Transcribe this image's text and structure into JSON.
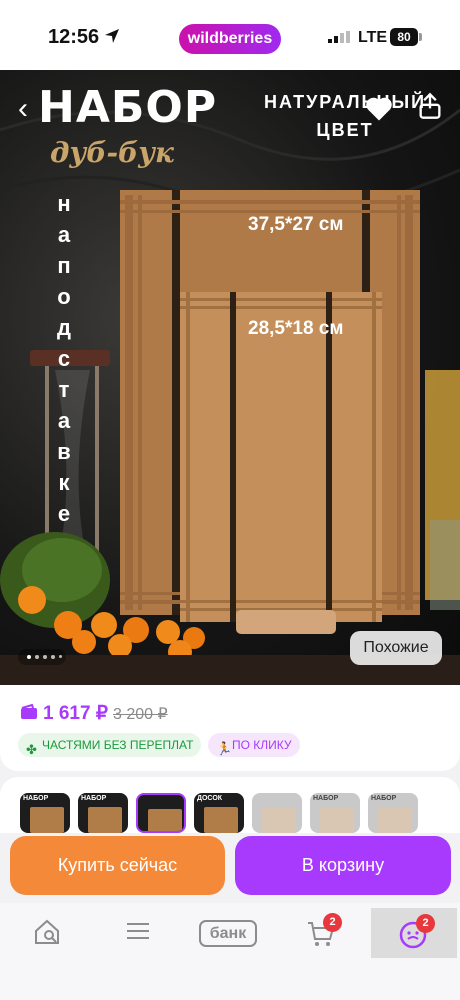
{
  "status_bar": {
    "time": "12:56",
    "brand": "wildberries",
    "network": "LTE",
    "battery": "80"
  },
  "hero": {
    "title": "НАБОР",
    "subtitle": "дуб-бук",
    "color_label": "НАТУРАЛЬНЫЙ ЦВЕТ",
    "vertical_text": [
      "н",
      "а",
      "п",
      "о",
      "д",
      "с",
      "т",
      "а",
      "в",
      "к",
      "е"
    ],
    "dimension_large": "37,5*27 см",
    "dimension_small": "28,5*18 см",
    "similar_button": "Похожие",
    "carousel_pages": 5,
    "carousel_active": 1
  },
  "price": {
    "current": "1 617 ₽",
    "old": "3 200 ₽"
  },
  "tags": {
    "installments": "ЧАСТЯМИ БЕЗ ПЕРЕПЛАТ",
    "one_click": "ПО КЛИКУ"
  },
  "thumbnails": [
    {
      "label": "НАБОР",
      "selected": false,
      "style": "dark"
    },
    {
      "label": "НАБОР",
      "selected": false,
      "style": "dark"
    },
    {
      "label": "",
      "selected": true,
      "style": "dark"
    },
    {
      "label": "ДОСОК",
      "selected": false,
      "style": "dark"
    },
    {
      "label": "",
      "selected": false,
      "style": "light"
    },
    {
      "label": "НАБОР",
      "selected": false,
      "style": "light"
    },
    {
      "label": "НАБОР",
      "selected": false,
      "style": "light"
    }
  ],
  "actions": {
    "buy_now": "Купить сейчас",
    "add_to_cart": "В корзину"
  },
  "bottom_nav": {
    "bank": "банк",
    "cart_badge": "2",
    "profile_badge": "2"
  },
  "colors": {
    "accent": "#a73afd",
    "buy": "#f5893a",
    "badge": "#e8373d",
    "success": "#1b9a3c"
  }
}
